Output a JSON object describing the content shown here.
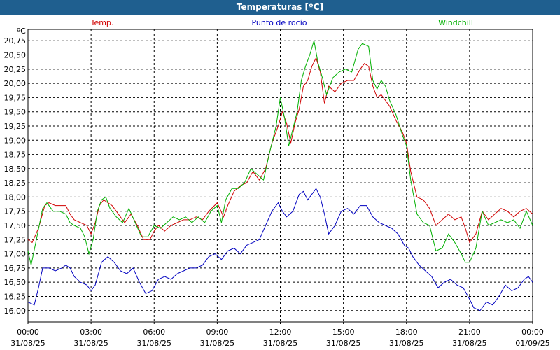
{
  "window": {
    "title": "Temperaturas [ºC]"
  },
  "colors": {
    "title_bar": "#1f5f8f",
    "temp": "#d00000",
    "dew": "#0000c0",
    "windchill": "#00b000",
    "grid": "#000000"
  },
  "chart_data": {
    "type": "line",
    "title": "Temperaturas [ºC]",
    "ylabel": "ºC",
    "ylim": [
      15.8,
      20.95
    ],
    "xlim": [
      0,
      24
    ],
    "grid": true,
    "legend": "top",
    "yticks": [
      "20,75",
      "20,50",
      "20,25",
      "20,00",
      "19,75",
      "19,50",
      "19,25",
      "19,00",
      "18,75",
      "18,50",
      "18,25",
      "18,00",
      "17,75",
      "17,50",
      "17,25",
      "17,00",
      "16,75",
      "16,50",
      "16,25",
      "16,00"
    ],
    "ytick_values": [
      20.75,
      20.5,
      20.25,
      20.0,
      19.75,
      19.5,
      19.25,
      19.0,
      18.75,
      18.5,
      18.25,
      18.0,
      17.75,
      17.5,
      17.25,
      17.0,
      16.75,
      16.5,
      16.25,
      16.0
    ],
    "xticks": [
      {
        "time": "00:00",
        "date": "31/08/25"
      },
      {
        "time": "03:00",
        "date": "31/08/25"
      },
      {
        "time": "06:00",
        "date": "31/08/25"
      },
      {
        "time": "09:00",
        "date": "31/08/25"
      },
      {
        "time": "12:00",
        "date": "31/08/25"
      },
      {
        "time": "15:00",
        "date": "31/08/25"
      },
      {
        "time": "18:00",
        "date": "31/08/25"
      },
      {
        "time": "21:00",
        "date": "31/08/25"
      },
      {
        "time": "00:00",
        "date": "01/09/25"
      }
    ],
    "xtick_hours": [
      0,
      3,
      6,
      9,
      12,
      15,
      18,
      21,
      24
    ],
    "series": [
      {
        "name": "Temp.",
        "color": "#d00000",
        "points": [
          [
            0,
            17.25
          ],
          [
            0.2,
            17.2
          ],
          [
            0.5,
            17.45
          ],
          [
            0.8,
            17.85
          ],
          [
            1.0,
            17.9
          ],
          [
            1.3,
            17.85
          ],
          [
            1.6,
            17.85
          ],
          [
            1.8,
            17.85
          ],
          [
            2.0,
            17.7
          ],
          [
            2.2,
            17.6
          ],
          [
            2.5,
            17.55
          ],
          [
            2.8,
            17.5
          ],
          [
            3.0,
            17.35
          ],
          [
            3.2,
            17.55
          ],
          [
            3.4,
            17.85
          ],
          [
            3.6,
            17.95
          ],
          [
            3.8,
            17.9
          ],
          [
            4.0,
            17.85
          ],
          [
            4.3,
            17.7
          ],
          [
            4.6,
            17.55
          ],
          [
            4.9,
            17.7
          ],
          [
            5.2,
            17.5
          ],
          [
            5.5,
            17.25
          ],
          [
            5.8,
            17.25
          ],
          [
            6.0,
            17.4
          ],
          [
            6.2,
            17.5
          ],
          [
            6.5,
            17.4
          ],
          [
            6.8,
            17.5
          ],
          [
            7.1,
            17.55
          ],
          [
            7.4,
            17.6
          ],
          [
            7.7,
            17.6
          ],
          [
            8.0,
            17.65
          ],
          [
            8.3,
            17.6
          ],
          [
            8.6,
            17.75
          ],
          [
            9.0,
            17.9
          ],
          [
            9.3,
            17.65
          ],
          [
            9.5,
            17.85
          ],
          [
            9.8,
            18.1
          ],
          [
            10.1,
            18.2
          ],
          [
            10.4,
            18.25
          ],
          [
            10.7,
            18.45
          ],
          [
            11.0,
            18.3
          ],
          [
            11.3,
            18.5
          ],
          [
            11.6,
            18.95
          ],
          [
            11.9,
            19.25
          ],
          [
            12.1,
            19.5
          ],
          [
            12.3,
            19.3
          ],
          [
            12.5,
            18.95
          ],
          [
            12.7,
            19.3
          ],
          [
            12.9,
            19.55
          ],
          [
            13.1,
            19.95
          ],
          [
            13.3,
            20.05
          ],
          [
            13.5,
            20.3
          ],
          [
            13.7,
            20.45
          ],
          [
            13.9,
            20.2
          ],
          [
            14.1,
            19.65
          ],
          [
            14.3,
            19.95
          ],
          [
            14.6,
            19.85
          ],
          [
            14.9,
            20.0
          ],
          [
            15.2,
            20.05
          ],
          [
            15.5,
            20.05
          ],
          [
            15.8,
            20.25
          ],
          [
            16.0,
            20.35
          ],
          [
            16.2,
            20.3
          ],
          [
            16.4,
            19.95
          ],
          [
            16.6,
            19.75
          ],
          [
            16.8,
            19.8
          ],
          [
            17.0,
            19.7
          ],
          [
            17.2,
            19.6
          ],
          [
            17.5,
            19.35
          ],
          [
            17.8,
            19.15
          ],
          [
            18.0,
            18.95
          ],
          [
            18.2,
            18.45
          ],
          [
            18.5,
            18.0
          ],
          [
            18.8,
            17.95
          ],
          [
            19.1,
            17.8
          ],
          [
            19.4,
            17.5
          ],
          [
            19.7,
            17.6
          ],
          [
            20.0,
            17.7
          ],
          [
            20.3,
            17.6
          ],
          [
            20.6,
            17.65
          ],
          [
            20.8,
            17.45
          ],
          [
            21.0,
            17.2
          ],
          [
            21.3,
            17.35
          ],
          [
            21.6,
            17.75
          ],
          [
            21.9,
            17.6
          ],
          [
            22.2,
            17.7
          ],
          [
            22.5,
            17.8
          ],
          [
            22.8,
            17.75
          ],
          [
            23.1,
            17.65
          ],
          [
            23.4,
            17.75
          ],
          [
            23.7,
            17.8
          ],
          [
            24.0,
            17.7
          ]
        ]
      },
      {
        "name": "Punto de rocío",
        "color": "#0000c0",
        "points": [
          [
            0,
            16.15
          ],
          [
            0.3,
            16.1
          ],
          [
            0.5,
            16.4
          ],
          [
            0.7,
            16.75
          ],
          [
            1.0,
            16.75
          ],
          [
            1.3,
            16.7
          ],
          [
            1.6,
            16.75
          ],
          [
            1.8,
            16.8
          ],
          [
            2.0,
            16.75
          ],
          [
            2.2,
            16.6
          ],
          [
            2.5,
            16.5
          ],
          [
            2.8,
            16.45
          ],
          [
            3.0,
            16.35
          ],
          [
            3.2,
            16.45
          ],
          [
            3.5,
            16.85
          ],
          [
            3.8,
            16.95
          ],
          [
            4.1,
            16.85
          ],
          [
            4.4,
            16.7
          ],
          [
            4.7,
            16.65
          ],
          [
            5.0,
            16.75
          ],
          [
            5.3,
            16.5
          ],
          [
            5.6,
            16.3
          ],
          [
            5.9,
            16.35
          ],
          [
            6.2,
            16.55
          ],
          [
            6.5,
            16.6
          ],
          [
            6.8,
            16.55
          ],
          [
            7.1,
            16.65
          ],
          [
            7.4,
            16.7
          ],
          [
            7.7,
            16.75
          ],
          [
            8.0,
            16.75
          ],
          [
            8.3,
            16.8
          ],
          [
            8.6,
            16.95
          ],
          [
            8.9,
            17.0
          ],
          [
            9.2,
            16.9
          ],
          [
            9.5,
            17.05
          ],
          [
            9.8,
            17.1
          ],
          [
            10.1,
            17.0
          ],
          [
            10.4,
            17.15
          ],
          [
            10.7,
            17.2
          ],
          [
            11.0,
            17.25
          ],
          [
            11.3,
            17.5
          ],
          [
            11.6,
            17.75
          ],
          [
            11.9,
            17.9
          ],
          [
            12.1,
            17.75
          ],
          [
            12.3,
            17.65
          ],
          [
            12.6,
            17.75
          ],
          [
            12.9,
            18.05
          ],
          [
            13.1,
            18.1
          ],
          [
            13.3,
            17.95
          ],
          [
            13.5,
            18.05
          ],
          [
            13.7,
            18.15
          ],
          [
            13.9,
            18.0
          ],
          [
            14.1,
            17.7
          ],
          [
            14.3,
            17.35
          ],
          [
            14.6,
            17.5
          ],
          [
            14.9,
            17.75
          ],
          [
            15.2,
            17.8
          ],
          [
            15.5,
            17.7
          ],
          [
            15.8,
            17.85
          ],
          [
            16.1,
            17.85
          ],
          [
            16.4,
            17.65
          ],
          [
            16.7,
            17.55
          ],
          [
            17.0,
            17.5
          ],
          [
            17.3,
            17.45
          ],
          [
            17.6,
            17.35
          ],
          [
            17.9,
            17.15
          ],
          [
            18.1,
            17.1
          ],
          [
            18.3,
            16.95
          ],
          [
            18.6,
            16.8
          ],
          [
            18.9,
            16.7
          ],
          [
            19.2,
            16.6
          ],
          [
            19.5,
            16.4
          ],
          [
            19.8,
            16.5
          ],
          [
            20.1,
            16.55
          ],
          [
            20.4,
            16.45
          ],
          [
            20.7,
            16.4
          ],
          [
            21.0,
            16.2
          ],
          [
            21.2,
            16.05
          ],
          [
            21.5,
            16.0
          ],
          [
            21.8,
            16.15
          ],
          [
            22.1,
            16.1
          ],
          [
            22.4,
            16.25
          ],
          [
            22.7,
            16.45
          ],
          [
            23.0,
            16.35
          ],
          [
            23.3,
            16.4
          ],
          [
            23.6,
            16.55
          ],
          [
            23.8,
            16.6
          ],
          [
            24.0,
            16.5
          ]
        ]
      },
      {
        "name": "Windchill",
        "color": "#00b000",
        "points": [
          [
            0,
            17.05
          ],
          [
            0.15,
            16.8
          ],
          [
            0.4,
            17.25
          ],
          [
            0.7,
            17.8
          ],
          [
            0.9,
            17.9
          ],
          [
            1.2,
            17.75
          ],
          [
            1.5,
            17.75
          ],
          [
            1.8,
            17.7
          ],
          [
            2.0,
            17.55
          ],
          [
            2.2,
            17.5
          ],
          [
            2.5,
            17.45
          ],
          [
            2.7,
            17.3
          ],
          [
            2.9,
            17.0
          ],
          [
            3.1,
            17.25
          ],
          [
            3.3,
            17.75
          ],
          [
            3.5,
            17.95
          ],
          [
            3.7,
            18.0
          ],
          [
            3.9,
            17.8
          ],
          [
            4.2,
            17.65
          ],
          [
            4.5,
            17.55
          ],
          [
            4.8,
            17.8
          ],
          [
            5.1,
            17.55
          ],
          [
            5.4,
            17.3
          ],
          [
            5.7,
            17.3
          ],
          [
            6.0,
            17.5
          ],
          [
            6.3,
            17.45
          ],
          [
            6.6,
            17.55
          ],
          [
            6.9,
            17.65
          ],
          [
            7.2,
            17.6
          ],
          [
            7.5,
            17.65
          ],
          [
            7.8,
            17.55
          ],
          [
            8.1,
            17.65
          ],
          [
            8.4,
            17.55
          ],
          [
            8.7,
            17.75
          ],
          [
            9.0,
            17.85
          ],
          [
            9.2,
            17.55
          ],
          [
            9.4,
            17.95
          ],
          [
            9.7,
            18.15
          ],
          [
            10.0,
            18.15
          ],
          [
            10.3,
            18.25
          ],
          [
            10.6,
            18.5
          ],
          [
            10.9,
            18.4
          ],
          [
            11.2,
            18.3
          ],
          [
            11.5,
            18.8
          ],
          [
            11.8,
            19.25
          ],
          [
            12.0,
            19.75
          ],
          [
            12.2,
            19.4
          ],
          [
            12.4,
            18.9
          ],
          [
            12.6,
            19.2
          ],
          [
            12.8,
            19.5
          ],
          [
            13.0,
            20.05
          ],
          [
            13.2,
            20.3
          ],
          [
            13.4,
            20.5
          ],
          [
            13.6,
            20.75
          ],
          [
            13.8,
            20.35
          ],
          [
            14.0,
            20.1
          ],
          [
            14.2,
            19.8
          ],
          [
            14.5,
            20.1
          ],
          [
            14.8,
            20.2
          ],
          [
            15.1,
            20.25
          ],
          [
            15.4,
            20.2
          ],
          [
            15.7,
            20.6
          ],
          [
            15.9,
            20.7
          ],
          [
            16.2,
            20.65
          ],
          [
            16.4,
            20.05
          ],
          [
            16.6,
            19.9
          ],
          [
            16.8,
            20.05
          ],
          [
            17.0,
            19.95
          ],
          [
            17.2,
            19.7
          ],
          [
            17.5,
            19.45
          ],
          [
            17.8,
            19.1
          ],
          [
            18.0,
            18.9
          ],
          [
            18.2,
            18.3
          ],
          [
            18.5,
            17.7
          ],
          [
            18.8,
            17.55
          ],
          [
            19.1,
            17.5
          ],
          [
            19.4,
            17.05
          ],
          [
            19.7,
            17.1
          ],
          [
            20.0,
            17.35
          ],
          [
            20.3,
            17.2
          ],
          [
            20.6,
            17.0
          ],
          [
            20.8,
            16.85
          ],
          [
            21.0,
            16.85
          ],
          [
            21.3,
            17.1
          ],
          [
            21.6,
            17.75
          ],
          [
            21.9,
            17.5
          ],
          [
            22.2,
            17.55
          ],
          [
            22.5,
            17.6
          ],
          [
            22.8,
            17.55
          ],
          [
            23.1,
            17.6
          ],
          [
            23.4,
            17.45
          ],
          [
            23.7,
            17.75
          ],
          [
            24.0,
            17.5
          ]
        ]
      }
    ]
  }
}
